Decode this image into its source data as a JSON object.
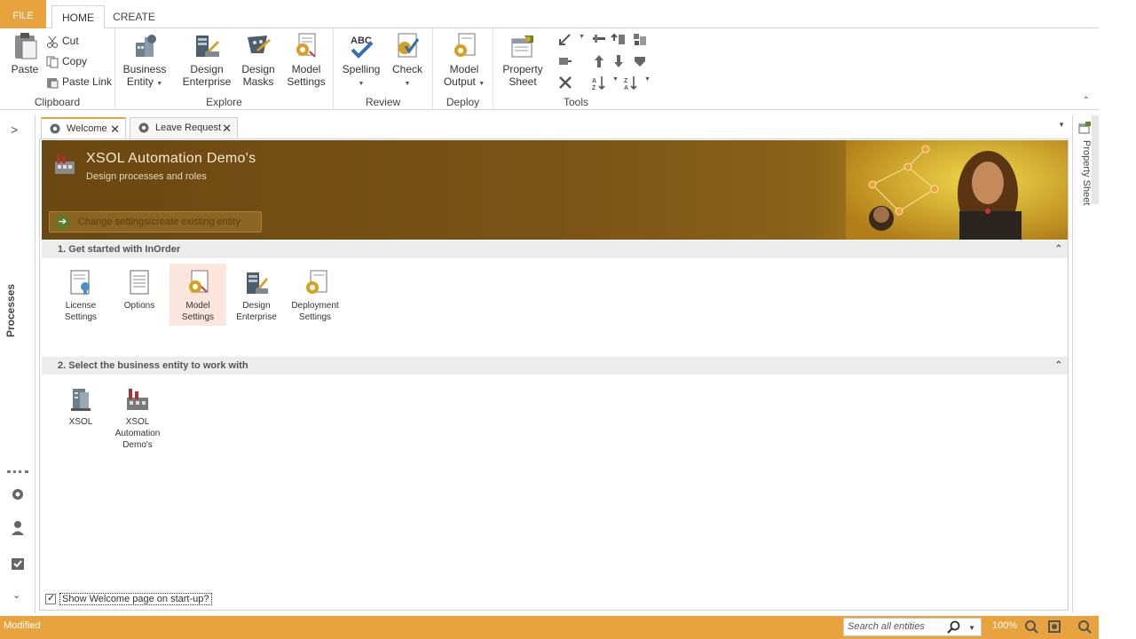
{
  "ribbon_tabs": {
    "file": "FILE",
    "home": "HOME",
    "create": "CREATE"
  },
  "clipboard": {
    "paste": "Paste",
    "cut": "Cut",
    "copy": "Copy",
    "paste_link": "Paste Link",
    "group_label": "Clipboard"
  },
  "explore": {
    "business_entity": [
      "Business",
      "Entity"
    ],
    "design_enterprise": [
      "Design",
      "Enterprise"
    ],
    "design_masks": [
      "Design",
      "Masks"
    ],
    "model_settings": [
      "Model",
      "Settings"
    ],
    "group_label": "Explore"
  },
  "review": {
    "spelling": "Spelling",
    "check": "Check",
    "group_label": "Review"
  },
  "deploy": {
    "model_output": [
      "Model",
      "Output"
    ],
    "group_label": "Deploy"
  },
  "tools": {
    "property_sheet": [
      "Property",
      "Sheet"
    ],
    "group_label": "Tools"
  },
  "left_rail": {
    "label": "Processes"
  },
  "right_rail": {
    "label": "Property Sheet"
  },
  "doc_tabs": [
    {
      "label": "Welcome"
    },
    {
      "label": "Leave Request"
    }
  ],
  "banner": {
    "title": "XSOL Automation Demo's",
    "subtitle": "Design processes and roles",
    "change_button": "Change settings/create existing entity"
  },
  "section1": {
    "title": "1. Get started with InOrder",
    "tiles": [
      {
        "lines": [
          "License",
          "Settings"
        ],
        "icon": "license-icon"
      },
      {
        "lines": [
          "Options",
          ""
        ],
        "icon": "options-icon"
      },
      {
        "lines": [
          "Model",
          "Settings"
        ],
        "icon": "model-settings-icon"
      },
      {
        "lines": [
          "Design",
          "Enterprise"
        ],
        "icon": "design-enterprise-icon"
      },
      {
        "lines": [
          "Deployment",
          "Settings"
        ],
        "icon": "deployment-icon"
      }
    ]
  },
  "section2": {
    "title": "2. Select the business entity to work with",
    "tiles": [
      {
        "lines": [
          "XSOL",
          "",
          ""
        ],
        "icon": "server-icon"
      },
      {
        "lines": [
          "XSOL",
          "Automation",
          "Demo's"
        ],
        "icon": "factory-icon"
      }
    ]
  },
  "startup_checkbox": {
    "label": "Show Welcome page on start-up?",
    "checked": true
  },
  "statusbar": {
    "status": "Modified",
    "search_placeholder": "Search all entities",
    "zoom": "100%"
  },
  "colors": {
    "accent": "#e8a33e",
    "banner_dark": "#6b4812",
    "banner_light": "#e8c830"
  }
}
